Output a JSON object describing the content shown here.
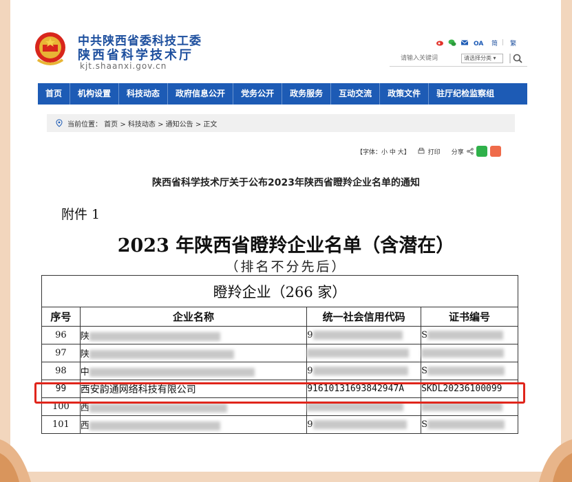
{
  "site": {
    "org_line1": "中共陕西省委科技工委",
    "org_line2": "陕西省科学技术厅",
    "domain": "kjt.shaanxi.gov.cn",
    "lang_simplified": "简",
    "lang_traditional": "繁",
    "lang_sep": "|",
    "search_placeholder": "请输入关键词",
    "category_select": "请选择分类 ▾"
  },
  "nav": [
    "首页",
    "机构设置",
    "科技动态",
    "政府信息公开",
    "党务公开",
    "政务服务",
    "互动交流",
    "政策文件",
    "驻厅纪检监察组"
  ],
  "breadcrumb": "当前位置： 首页 > 科技动态 > 通知公告 > 正文",
  "tools": {
    "font_size": "【字体：小 中 大】",
    "print": "打印",
    "share": "分享"
  },
  "article_title": "陕西省科学技术厅关于公布2023年陕西省瞪羚企业名单的通知",
  "document": {
    "attachment": "附件 1",
    "title": "2023 年陕西省瞪羚企业名单（含潜在）",
    "subtitle": "（排名不分先后）",
    "table_caption": "瞪羚企业（266 家）",
    "columns": [
      "序号",
      "企业名称",
      "统一社会信用代码",
      "证书编号"
    ],
    "rows": [
      {
        "no": "96",
        "name": "陕",
        "code": "9",
        "cert": "S"
      },
      {
        "no": "97",
        "name": "陕",
        "code": "",
        "cert": ""
      },
      {
        "no": "98",
        "name": "中",
        "code": "9",
        "cert": "S"
      },
      {
        "no": "99",
        "name": "西安韵通网络科技有限公司",
        "code": "91610131693842947A",
        "cert": "SKDL20236100099"
      },
      {
        "no": "100",
        "name": "西",
        "code": "",
        "cert": ""
      },
      {
        "no": "101",
        "name": "西",
        "code": "9",
        "cert": "S"
      }
    ]
  },
  "colors": {
    "nav_bg": "#1d5bb5",
    "brand_text": "#1d4f9e",
    "highlight": "#e0251b"
  }
}
